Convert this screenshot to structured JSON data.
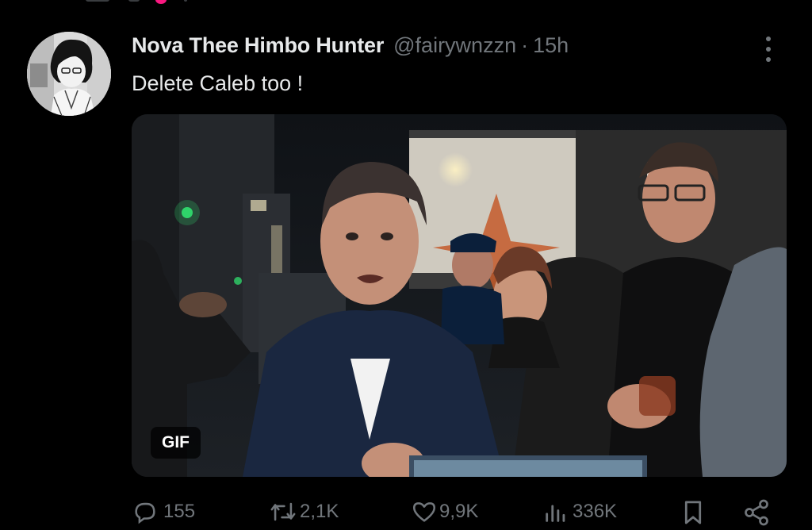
{
  "post": {
    "author_name": "Nova Thee Himbo Hunter",
    "handle": "@fairywnzzn",
    "separator": "·",
    "time": "15h",
    "text": "Delete Caleb too !",
    "media": {
      "badge": "GIF"
    }
  },
  "actions": {
    "replies": "155",
    "reposts": "2,1K",
    "likes": "9,9K",
    "views": "336K"
  },
  "icons": {
    "reply": "reply-icon",
    "repost": "repost-icon",
    "like": "heart-icon",
    "views": "views-icon",
    "bookmark": "bookmark-icon",
    "share": "share-icon",
    "more": "more-icon"
  },
  "colors": {
    "background": "#000000",
    "primary_text": "#e7e9ea",
    "secondary_text": "#71767b",
    "accent_pink": "#f91880"
  }
}
